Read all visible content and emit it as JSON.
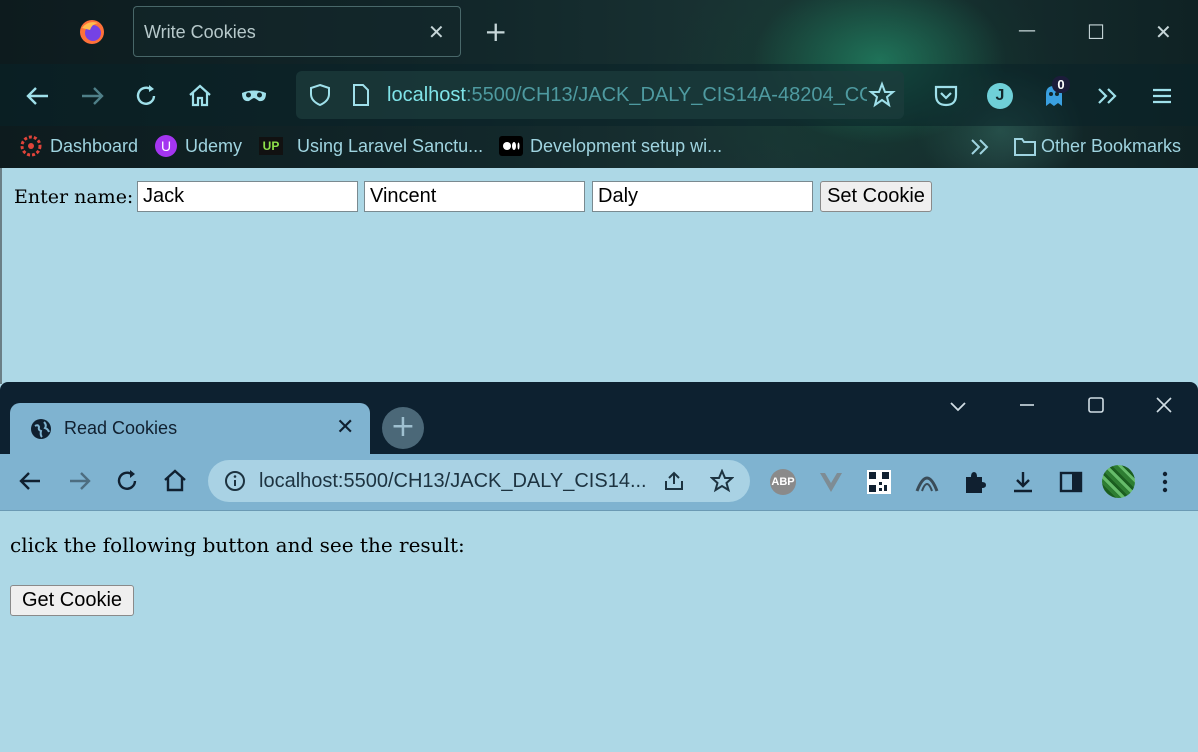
{
  "firefox": {
    "tab_title": "Write Cookies",
    "url_host": "localhost",
    "url_path": ":5500/CH13/JACK_DALY_CIS14A-48204_CO",
    "account_initial": "J",
    "badge_count": "0",
    "bookmarks": [
      "Dashboard",
      "Udemy",
      "Using Laravel Sanctu...",
      "Development setup wi..."
    ],
    "other_bookmarks": "Other Bookmarks",
    "bookmark_up_label": "UP",
    "page": {
      "label": "Enter name:",
      "first": "Jack",
      "middle": "Vincent",
      "last": "Daly",
      "button": "Set Cookie"
    }
  },
  "chrome": {
    "tab_title": "Read Cookies",
    "url": "localhost:5500/CH13/JACK_DALY_CIS14...",
    "abp_label": "ABP",
    "page": {
      "text": "click the following button and see the result:",
      "button": "Get Cookie"
    }
  },
  "colors": {
    "page_bg": "#add8e6",
    "chrome_tab": "#7fb3d0",
    "chrome_dark": "#0d2130",
    "firefox_url_host": "#7fe3e8"
  }
}
